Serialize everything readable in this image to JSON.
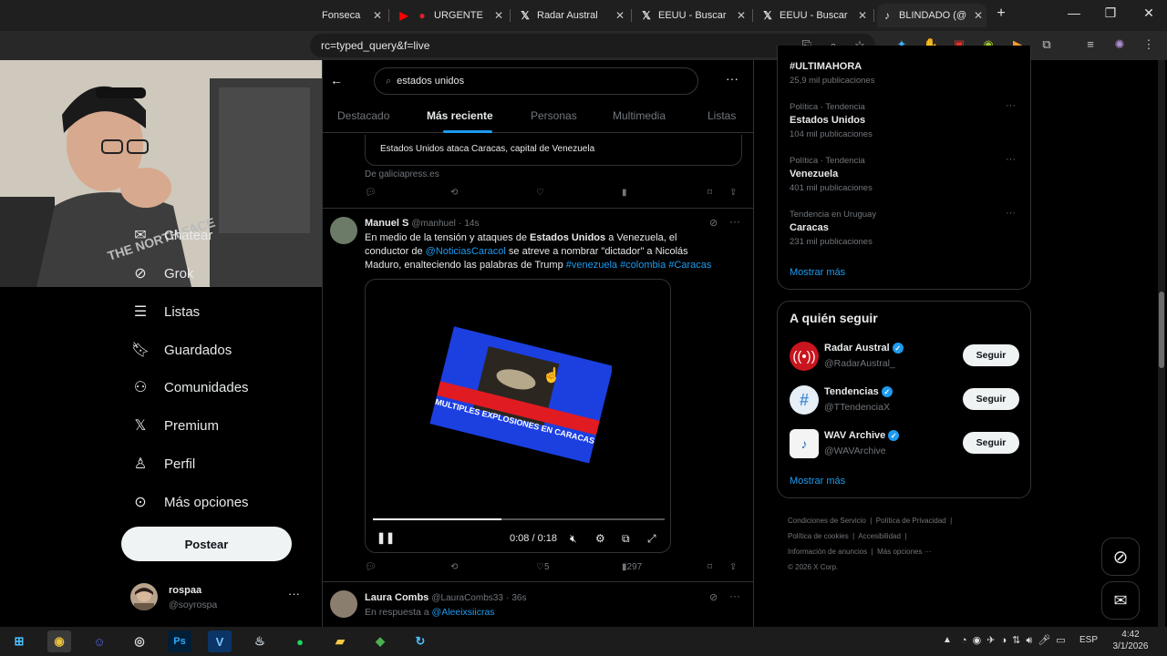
{
  "browser": {
    "tabs": [
      {
        "title": "Fonseca"
      },
      {
        "title": "URGENTE"
      },
      {
        "title": "Radar Austral"
      },
      {
        "title": "EEUU - Buscar"
      },
      {
        "title": "EEUU - Buscar"
      },
      {
        "title": "BLINDADO (@"
      }
    ],
    "new_tab": "+",
    "url": "rc=typed_query&f=live"
  },
  "sidebar": {
    "items": [
      {
        "label": "Chatear",
        "icon": "mail-icon"
      },
      {
        "label": "Grok",
        "icon": "grok-icon"
      },
      {
        "label": "Listas",
        "icon": "list-icon"
      },
      {
        "label": "Guardados",
        "icon": "bookmark-icon"
      },
      {
        "label": "Comunidades",
        "icon": "communities-icon"
      },
      {
        "label": "Premium",
        "icon": "x-icon"
      },
      {
        "label": "Perfil",
        "icon": "person-icon"
      },
      {
        "label": "Más opciones",
        "icon": "more-circle-icon"
      }
    ],
    "post_label": "Postear",
    "account": {
      "name": "rospaa",
      "handle": "@soyrospa"
    }
  },
  "search": {
    "query": "estados unidos",
    "tabs": [
      "Destacado",
      "Más reciente",
      "Personas",
      "Multimedia",
      "Listas"
    ],
    "active_tab": "Más reciente"
  },
  "feed": {
    "card_title": "Estados Unidos ataca Caracas, capital de Venezuela",
    "card_source": "De galiciapress.es",
    "tweet1": {
      "name": "Manuel S",
      "handle": "@manhuel",
      "time": "14s",
      "text_a": "En medio de la tensión y ataques de ",
      "text_b": "Estados Unidos",
      "text_c": " a Venezuela, el",
      "text_d": "conductor de ",
      "mention": "@NoticiasCaracol",
      "text_e": "  se atreve a nombrar \"dictador\" a Nicolás",
      "text_f": "Maduro, enalteciendo las palabras de Trump ",
      "hashtags": "#venezuela #colombia #Caracas",
      "video_caption": "MULTIPLES EXPLOSIONES EN CARACAS",
      "video_time": "0:08 / 0:18",
      "video_progress": 0.44,
      "likes": "5",
      "views": "297"
    },
    "tweet2": {
      "name": "Laura Combs",
      "handle": "@LauraCombs33",
      "time": "36s",
      "reply_prefix": "En respuesta a ",
      "reply_to": "@Aleeixsiicras"
    }
  },
  "trends": {
    "top": {
      "name": "#ULTIMAHORA",
      "count": "25,9 mil publicaciones"
    },
    "items": [
      {
        "meta": "Política · Tendencia",
        "name": "Estados Unidos",
        "count": "104 mil publicaciones"
      },
      {
        "meta": "Política · Tendencia",
        "name": "Venezuela",
        "count": "401 mil publicaciones"
      },
      {
        "meta": "Tendencia en Uruguay",
        "name": "Caracas",
        "count": "231 mil publicaciones"
      }
    ],
    "show_more": "Mostrar más"
  },
  "who_to_follow": {
    "title": "A quién seguir",
    "accounts": [
      {
        "name": "Radar Austral",
        "handle": "@RadarAustral_",
        "button": "Seguir"
      },
      {
        "name": "Tendencias",
        "handle": "@TTendenciaX",
        "button": "Seguir"
      },
      {
        "name": "WAV Archive",
        "handle": "@WAVArchive",
        "button": "Seguir"
      }
    ],
    "show_more": "Mostrar más"
  },
  "footer": {
    "links": [
      "Condiciones de Servicio",
      "Política de Privacidad",
      "Política de cookies",
      "Accesibilidad",
      "Información de anuncios",
      "Más opciones ···"
    ],
    "copyright": "© 2026 X Corp."
  },
  "taskbar": {
    "lang": "ESP",
    "time": "4:42",
    "date": "3/1/2026"
  },
  "colors": {
    "accent": "#1d9bf0",
    "background": "#000000"
  }
}
